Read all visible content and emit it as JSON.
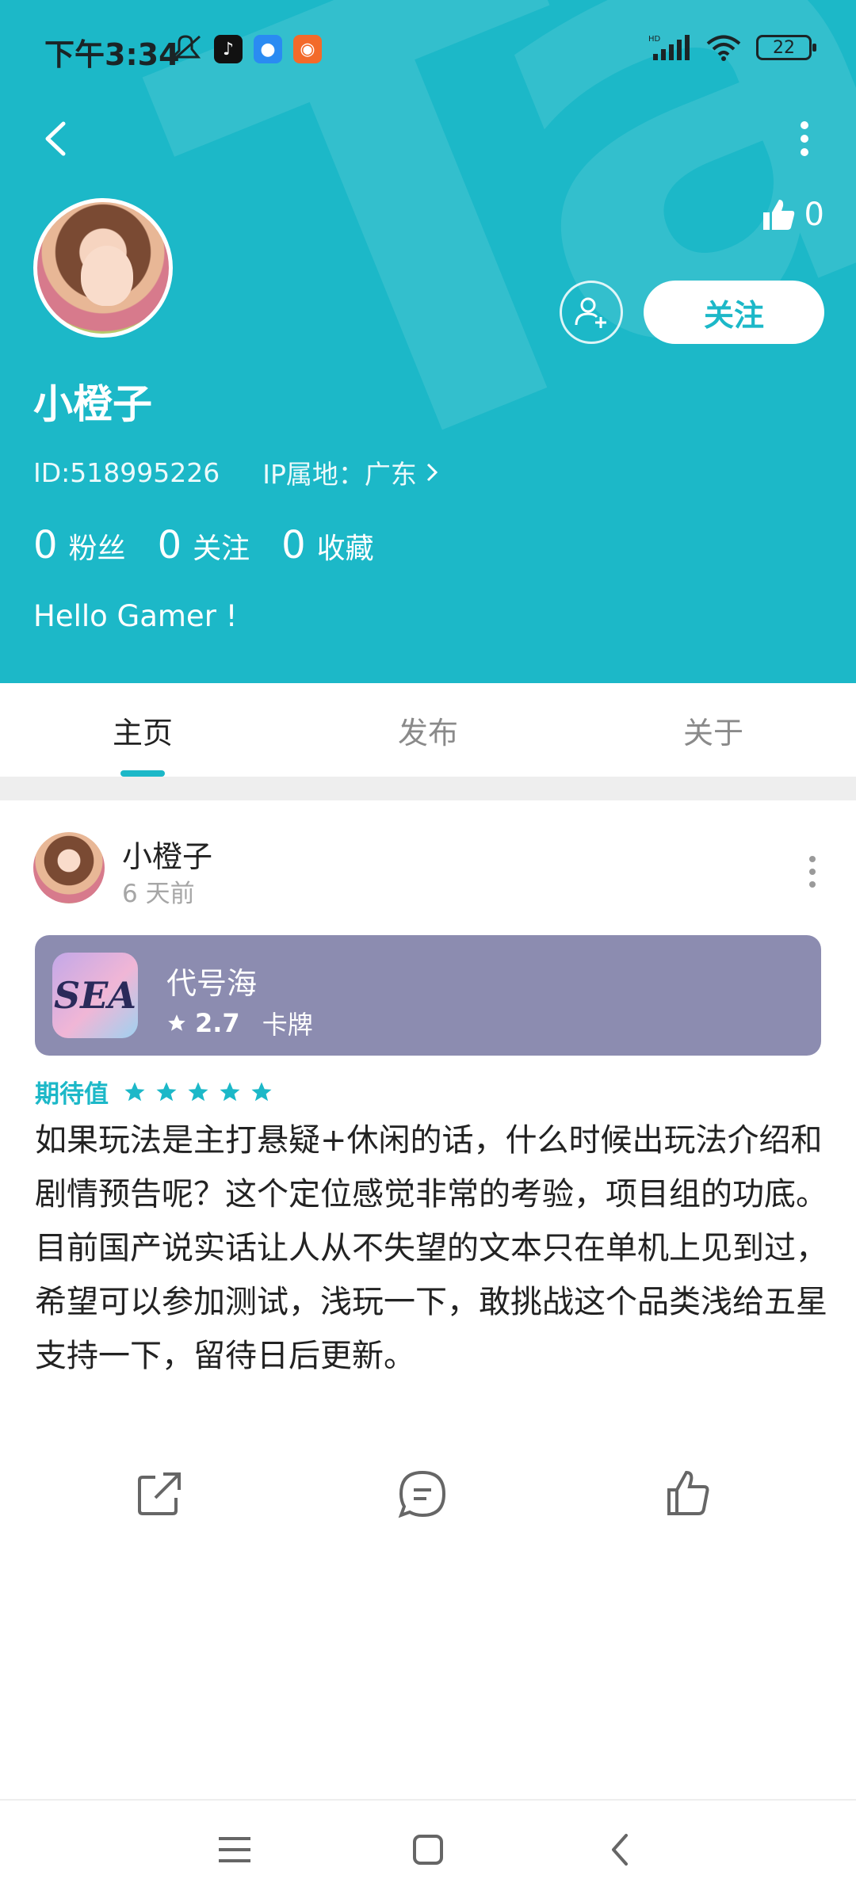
{
  "status_bar": {
    "time": "下午3:34",
    "battery": "22",
    "network": "HD"
  },
  "profile": {
    "likes": "0",
    "follow_label": "关注",
    "name": "小橙子",
    "id_text": "ID:518995226",
    "ip_text": "IP属地：广东",
    "stats": [
      {
        "num": "0",
        "label": "粉丝"
      },
      {
        "num": "0",
        "label": "关注"
      },
      {
        "num": "0",
        "label": "收藏"
      }
    ],
    "bio": "Hello Gamer !"
  },
  "tabs": [
    {
      "label": "主页",
      "active": true
    },
    {
      "label": "发布",
      "active": false
    },
    {
      "label": "关于",
      "active": false
    }
  ],
  "post": {
    "author": "小橙子",
    "time": "6 天前",
    "game": {
      "icon_text": "SEA",
      "title": "代号海",
      "rating": "2.7",
      "category": "卡牌"
    },
    "expect_label": "期待值",
    "stars": 5,
    "body": "如果玩法是主打悬疑+休闲的话，什么时候出玩法介绍和剧情预告呢？这个定位感觉非常的考验，项目组的功底。目前国产说实话让人从不失望的文本只在单机上见到过，希望可以参加测试，浅玩一下，敢挑战这个品类浅给五星支持一下，留待日后更新。"
  },
  "colors": {
    "accent": "#1cb8c8",
    "card": "#8c8cb0"
  }
}
